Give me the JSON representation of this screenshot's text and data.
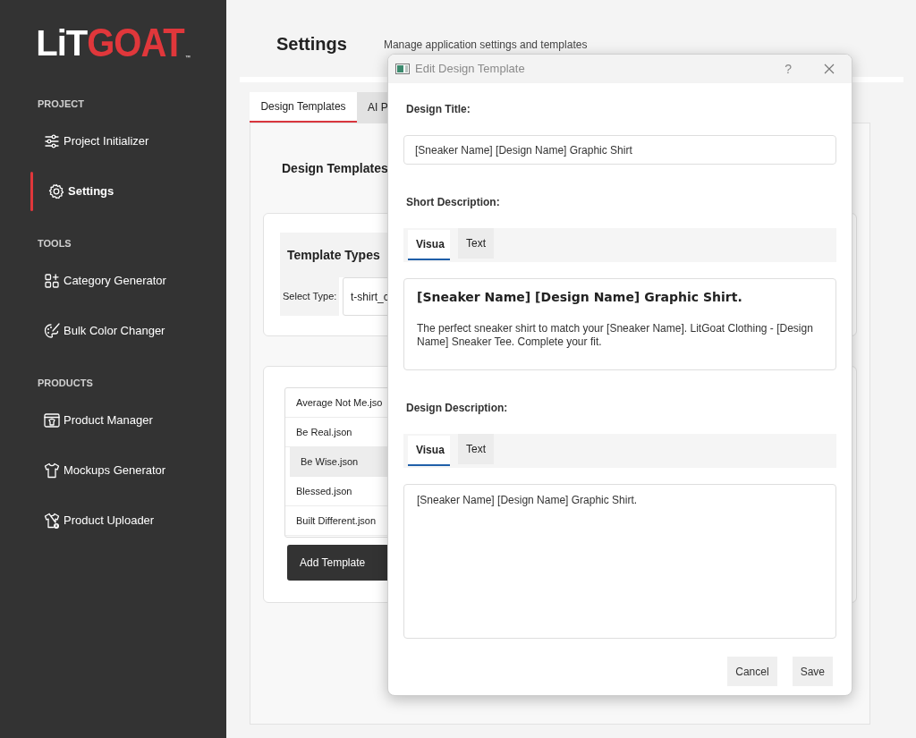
{
  "logo": {
    "lit": "LiT",
    "goat": "GOAT",
    "tm": "™"
  },
  "sidebar": {
    "sections": [
      {
        "title": "PROJECT",
        "items": [
          {
            "label": "Project Initializer",
            "selected": false
          },
          {
            "label": "Settings",
            "selected": true
          }
        ]
      },
      {
        "title": "TOOLS",
        "items": [
          {
            "label": "Category Generator",
            "selected": false
          },
          {
            "label": "Bulk Color Changer",
            "selected": false
          }
        ]
      },
      {
        "title": "PRODUCTS",
        "items": [
          {
            "label": "Product Manager",
            "selected": false
          },
          {
            "label": "Mockups Generator",
            "selected": false
          },
          {
            "label": "Product Uploader",
            "selected": false
          }
        ]
      }
    ]
  },
  "header": {
    "title": "Settings",
    "subtitle": "Manage application settings and templates"
  },
  "tabs": [
    {
      "label": "Design Templates",
      "selected": true
    },
    {
      "label": "AI P",
      "selected": false
    }
  ],
  "panel": {
    "heading": "Design Templates",
    "template_types": {
      "title": "Template Types",
      "select_label": "Select Type:",
      "select_value": "t-shirt_c"
    },
    "templates": {
      "items": [
        {
          "label": "Average Not Me.jso",
          "selected": false
        },
        {
          "label": "Be Real.json",
          "selected": false
        },
        {
          "label": "Be Wise.json",
          "selected": true
        },
        {
          "label": "Blessed.json",
          "selected": false
        },
        {
          "label": "Built Different.json",
          "selected": false
        }
      ],
      "add_button": "Add Template"
    }
  },
  "dialog": {
    "title": "Edit Design Template",
    "help": "?",
    "design_title": {
      "label": "Design Title:",
      "value": "[Sneaker Name] [Design Name] Graphic Shirt"
    },
    "editors": [
      {
        "label": "Short Description:",
        "tabs": [
          {
            "label": "Visua",
            "selected": true
          },
          {
            "label": "Text",
            "selected": false
          }
        ],
        "blocks": [
          {
            "kind": "heading",
            "text": "[Sneaker Name] [Design Name] Graphic Shirt."
          },
          {
            "kind": "paragraph",
            "text": "The perfect sneaker shirt to match your [Sneaker Name]. LitGoat Clothing - [Design Name] Sneaker Tee. Complete your fit."
          }
        ]
      },
      {
        "label": "Design Description:",
        "tabs": [
          {
            "label": "Visua",
            "selected": true
          },
          {
            "label": "Text",
            "selected": false
          }
        ],
        "blocks": [
          {
            "kind": "paragraph",
            "text": "[Sneaker Name] [Design Name] Graphic Shirt."
          }
        ]
      }
    ],
    "buttons": [
      {
        "label": "Cancel"
      },
      {
        "label": "Save"
      }
    ]
  }
}
